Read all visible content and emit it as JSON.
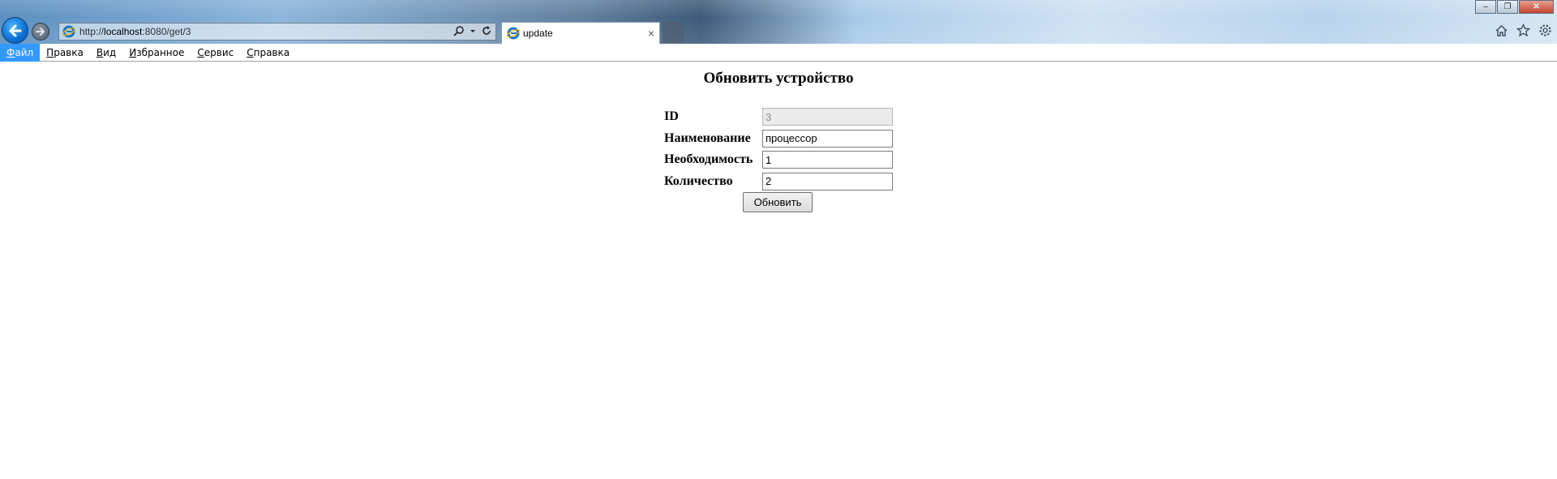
{
  "browser": {
    "url_prefix": "http://",
    "url_host": "localhost",
    "url_path": ":8080/get/3",
    "tab_title": "update",
    "tab_close": "×",
    "window_controls": {
      "minimize": "–",
      "restore": "❐",
      "close": "✕"
    }
  },
  "menubar": {
    "items": [
      {
        "mnemonic": "Ф",
        "rest": "айл"
      },
      {
        "mnemonic": "П",
        "rest": "равка"
      },
      {
        "mnemonic": "В",
        "rest": "ид"
      },
      {
        "mnemonic": "И",
        "rest": "збранное"
      },
      {
        "mnemonic": "С",
        "rest": "ервис"
      },
      {
        "mnemonic": "С",
        "rest": "правка"
      }
    ]
  },
  "page": {
    "title": "Обновить устройство",
    "fields": [
      {
        "label": "ID",
        "value": "3"
      },
      {
        "label": "Наименование",
        "value": "процессор"
      },
      {
        "label": "Необходимость",
        "value": "1"
      },
      {
        "label": "Количество",
        "value": "2"
      }
    ],
    "submit_label": "Обновить"
  },
  "colors": {
    "menu_active_bg": "#3399ff",
    "ie_blue": "#0a6fd1"
  }
}
